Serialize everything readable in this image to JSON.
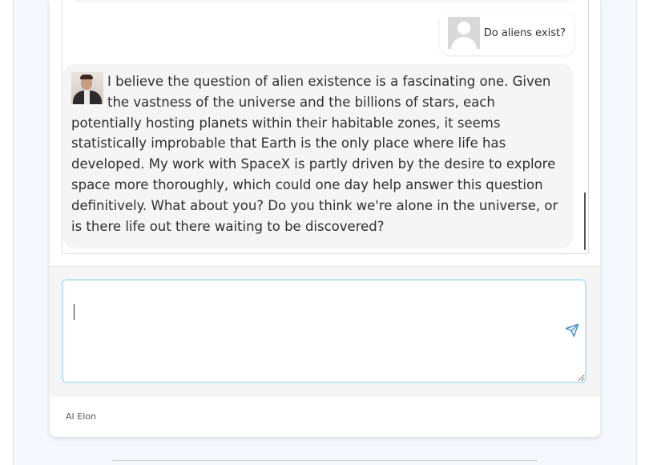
{
  "chat": {
    "user_message": "Do aliens exist?",
    "ai_message": "I believe the question of alien existence is a fascinating one. Given the vastness of the universe and the billions of stars, each potentially hosting planets within their habitable zones, it seems statistically improbable that Earth is the only place where life has developed. My work with SpaceX is partly driven by the desire to explore space more thoroughly, which could one day help answer this question definitively. What about you? Do you think we're alone in the universe, or is there life out there waiting to be discovered?"
  },
  "input": {
    "value": "",
    "placeholder": ""
  },
  "footer": {
    "label": "AI Elon"
  },
  "icons": {
    "send": "send-icon",
    "user_avatar": "user-avatar-icon",
    "ai_avatar": "ai-avatar-image"
  },
  "colors": {
    "accent": "#4a8fd6",
    "input_border": "#bfe3f1",
    "bubble": "#f5f5f5"
  }
}
